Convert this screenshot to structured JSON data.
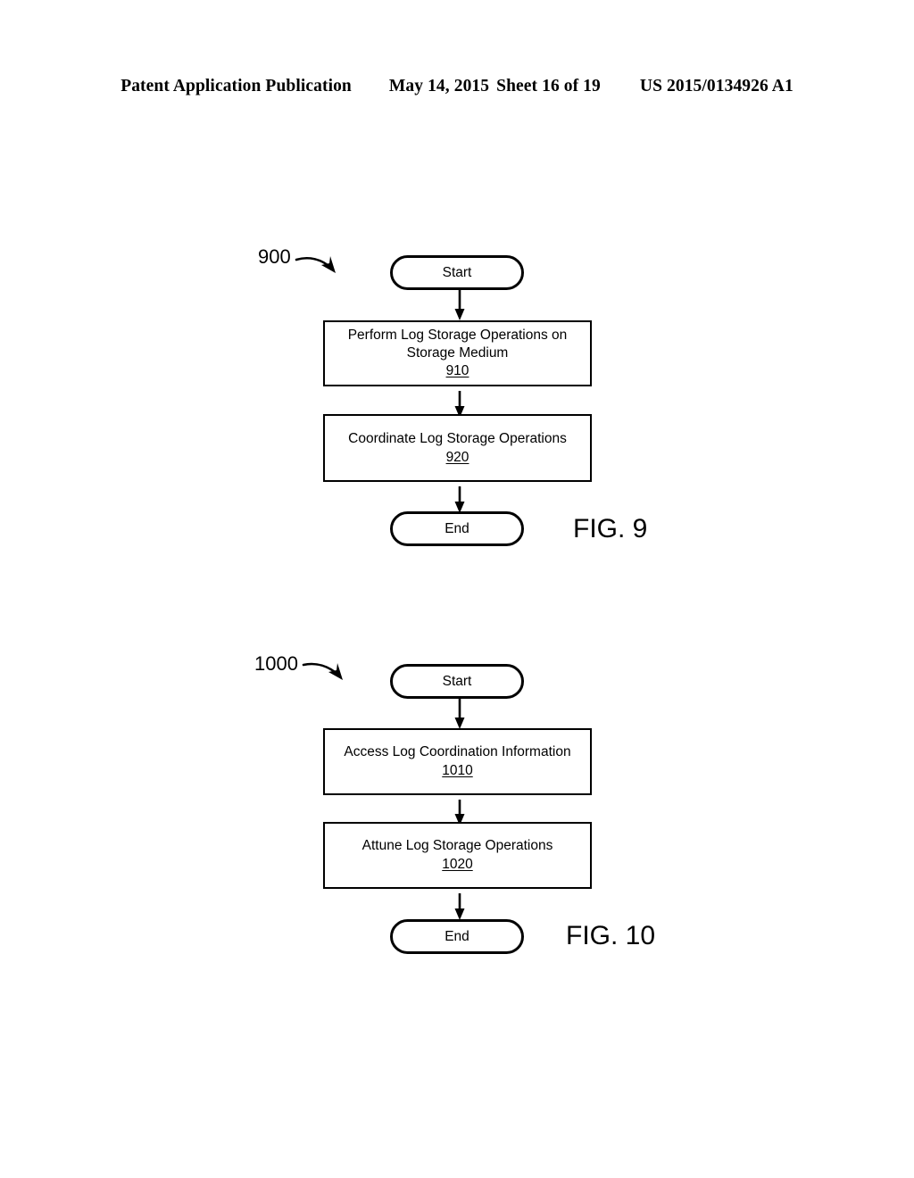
{
  "header": {
    "publication": "Patent Application Publication",
    "date": "May 14, 2015",
    "sheet": "Sheet 16 of 19",
    "publication_number": "US 2015/0134926 A1"
  },
  "colors": {
    "ink": "#000000",
    "paper": "#ffffff"
  },
  "figures": [
    {
      "caption": "FIG. 9",
      "callout": "900",
      "nodes": [
        {
          "type": "terminal",
          "label": "Start"
        },
        {
          "type": "process",
          "lines": [
            "Perform Log Storage Operations on",
            "Storage Medium"
          ],
          "ref": "910"
        },
        {
          "type": "process",
          "lines": [
            "Coordinate Log Storage Operations"
          ],
          "ref": "920"
        },
        {
          "type": "terminal",
          "label": "End"
        }
      ]
    },
    {
      "caption": "FIG. 10",
      "callout": "1000",
      "nodes": [
        {
          "type": "terminal",
          "label": "Start"
        },
        {
          "type": "process",
          "lines": [
            "Access Log Coordination Information"
          ],
          "ref": "1010"
        },
        {
          "type": "process",
          "lines": [
            "Attune Log Storage Operations"
          ],
          "ref": "1020"
        },
        {
          "type": "terminal",
          "label": "End"
        }
      ]
    }
  ]
}
